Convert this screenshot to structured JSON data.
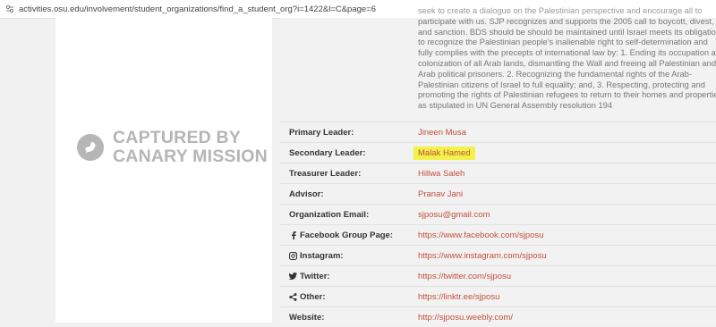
{
  "url_bar": {
    "url": "activities.osu.edu/involvement/student_organizations/find_a_student_org?i=1422&l=C&page=6"
  },
  "watermark": {
    "line1": "CAPTURED BY",
    "line2": "CANARY MISSION"
  },
  "description_lines": [
    "seek to create a dialogue on the Palestinian perspective and encourage all to",
    "participate with us. SJP recognizes and supports the 2005 call to boycott, divest,",
    "and sanction. BDS should be should be maintained until Israel meets its obligation",
    "to recognize the Palestinian people's inalienable right to self-determination and",
    "fully complies with the precepts of international law by: 1. Ending its occupation and",
    "colonization of all Arab lands, dismantling the Wall and freeing all Palestinian and",
    "Arab political prisoners. 2. Recognizing the fundamental rights of the Arab-",
    "Palestinian citizens of Israel to full equality; and, 3. Respecting, protecting and",
    "promoting the rights of Palestinian refugees to return to their homes and properties",
    "as stipulated in UN General Assembly resolution 194"
  ],
  "details": [
    {
      "label": "Primary Leader:",
      "value": "Jineen Musa"
    },
    {
      "label": "Secondary Leader:",
      "value": "Malak Hamed"
    },
    {
      "label": "Treasurer Leader:",
      "value": "Hillwa Saleh"
    },
    {
      "label": "Advisor:",
      "value": "Pranav Jani"
    },
    {
      "label": "Organization Email:",
      "value": "sjposu@gmail.com"
    },
    {
      "label": "Facebook Group Page:",
      "value": "https://www.facebook.com/sjposu",
      "icon": "facebook-icon"
    },
    {
      "label": "Instagram:",
      "value": "https://www.instagram.com/sjposu",
      "icon": "instagram-icon"
    },
    {
      "label": "Twitter:",
      "value": "https://twitter.com/sjposu",
      "icon": "twitter-icon"
    },
    {
      "label": "Other:",
      "value": "https://linktr.ee/sjposu",
      "icon": "share-icon"
    },
    {
      "label": "Website:",
      "value": "http://sjposu.weebly.com/"
    }
  ],
  "colors": {
    "link": "#c0503a",
    "highlight": "#f3f24a"
  }
}
